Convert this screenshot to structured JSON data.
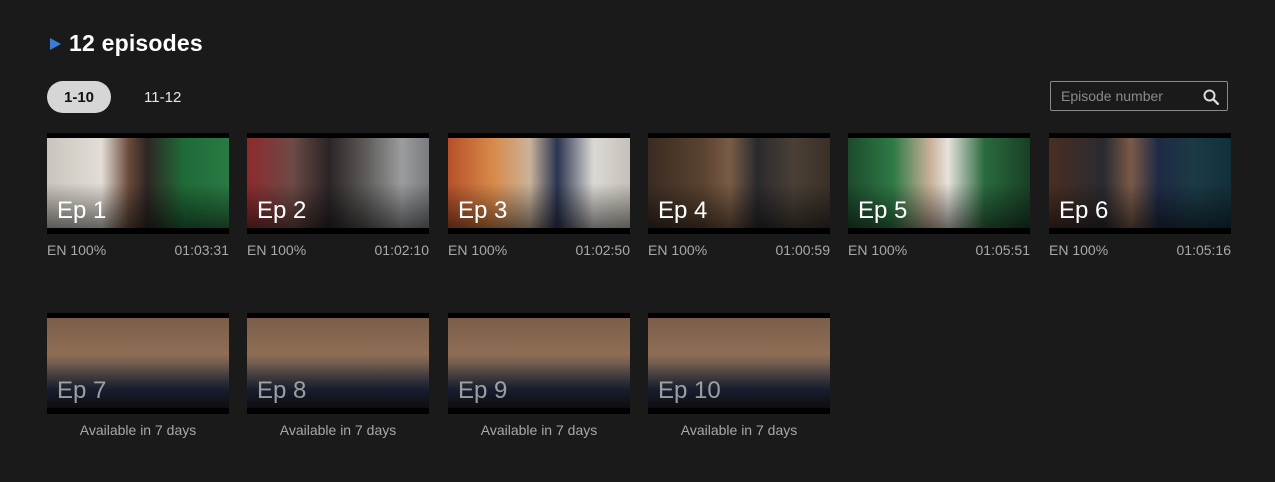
{
  "header": {
    "title": "12 episodes",
    "icon": "play-triangle-icon",
    "accent": "#3d7bd9"
  },
  "tabs": [
    {
      "label": "1-10",
      "active": true
    },
    {
      "label": "11-12",
      "active": false
    }
  ],
  "search": {
    "placeholder": "Episode number",
    "icon": "search-icon"
  },
  "episodes": [
    {
      "label": "Ep 1",
      "subtitle": "EN 100%",
      "duration": "01:03:31"
    },
    {
      "label": "Ep 2",
      "subtitle": "EN 100%",
      "duration": "01:02:10"
    },
    {
      "label": "Ep 3",
      "subtitle": "EN 100%",
      "duration": "01:02:50"
    },
    {
      "label": "Ep 4",
      "subtitle": "EN 100%",
      "duration": "01:00:59"
    },
    {
      "label": "Ep 5",
      "subtitle": "EN 100%",
      "duration": "01:05:51"
    },
    {
      "label": "Ep 6",
      "subtitle": "EN 100%",
      "duration": "01:05:16"
    }
  ],
  "upcoming": [
    {
      "label": "Ep 7",
      "availability": "Available in 7 days"
    },
    {
      "label": "Ep 8",
      "availability": "Available in 7 days"
    },
    {
      "label": "Ep 9",
      "availability": "Available in 7 days"
    },
    {
      "label": "Ep 10",
      "availability": "Available in 7 days"
    }
  ]
}
